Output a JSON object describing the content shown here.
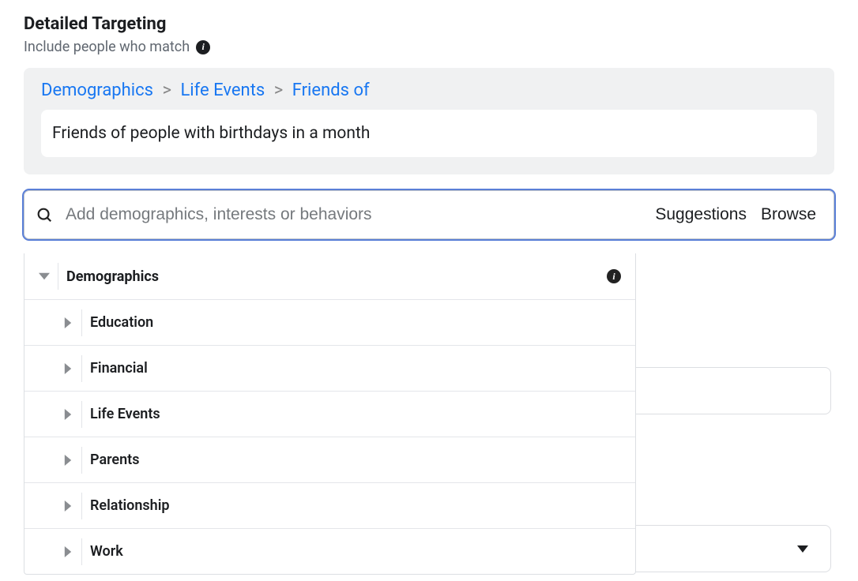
{
  "heading": "Detailed Targeting",
  "subheading": "Include people who match",
  "breadcrumb": {
    "level1": "Demographics",
    "level2": "Life Events",
    "level3": "Friends of"
  },
  "selected_option": "Friends of people with birthdays in a month",
  "search": {
    "placeholder": "Add demographics, interests or behaviors",
    "suggestions_label": "Suggestions",
    "browse_label": "Browse"
  },
  "dropdown": {
    "header": "Demographics",
    "items": [
      {
        "label": "Education"
      },
      {
        "label": "Financial"
      },
      {
        "label": "Life Events"
      },
      {
        "label": "Parents"
      },
      {
        "label": "Relationship"
      },
      {
        "label": "Work"
      }
    ]
  }
}
